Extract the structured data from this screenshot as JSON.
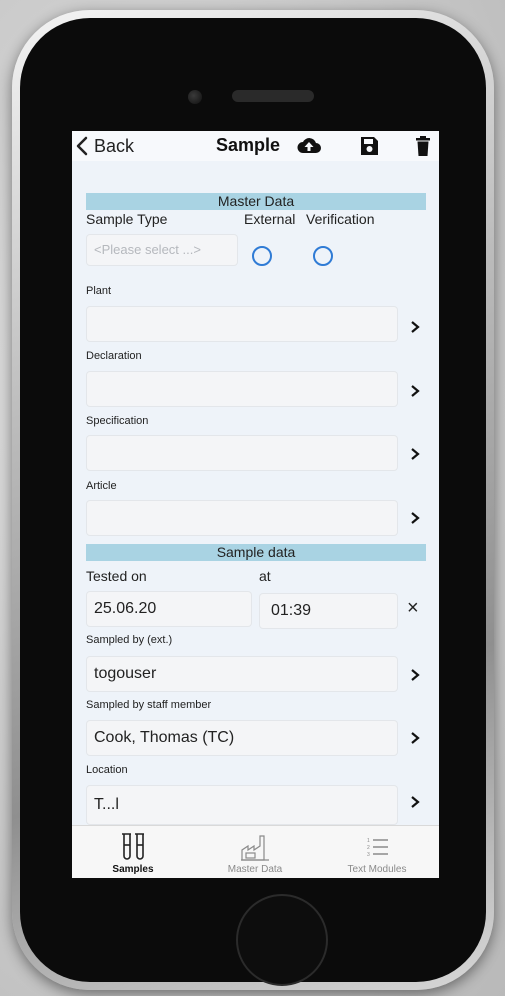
{
  "navbar": {
    "back_label": "Back",
    "title": "Sample",
    "icons": [
      "cloud-upload-icon",
      "save-icon",
      "trash-icon"
    ]
  },
  "master_data": {
    "header": "Master Data",
    "sample_type_label": "Sample Type",
    "sample_type_placeholder": "<Please select ...>",
    "external_label": "External",
    "verification_label": "Verification",
    "plant_label": "Plant",
    "plant_value": "",
    "declaration_label": "Declaration",
    "declaration_value": "",
    "specification_label": "Specification",
    "specification_value": "",
    "article_label": "Article",
    "article_value": ""
  },
  "sample_data": {
    "header": "Sample data",
    "tested_on_label": "Tested on",
    "at_label": "at",
    "tested_on_date": "25.06.20",
    "tested_on_time": "01:39",
    "clear_symbol": "×",
    "sampled_by_ext_label": "Sampled by (ext.)",
    "sampled_by_ext_value": "togouser",
    "sampled_by_staff_label": "Sampled by staff member",
    "sampled_by_staff_value": "Cook, Thomas (TC)",
    "location_label": "Location",
    "location_value": "T...l"
  },
  "tabbar": {
    "tabs": [
      {
        "label": "Samples",
        "icon": "test-tubes-icon",
        "active": true
      },
      {
        "label": "Master Data",
        "icon": "factory-icon",
        "active": false
      },
      {
        "label": "Text Modules",
        "icon": "numbered-list-icon",
        "active": false
      }
    ]
  },
  "colors": {
    "section_header": "#a9d3e3",
    "radio": "#2f7bd5",
    "screen_bg": "#eef3f9"
  }
}
